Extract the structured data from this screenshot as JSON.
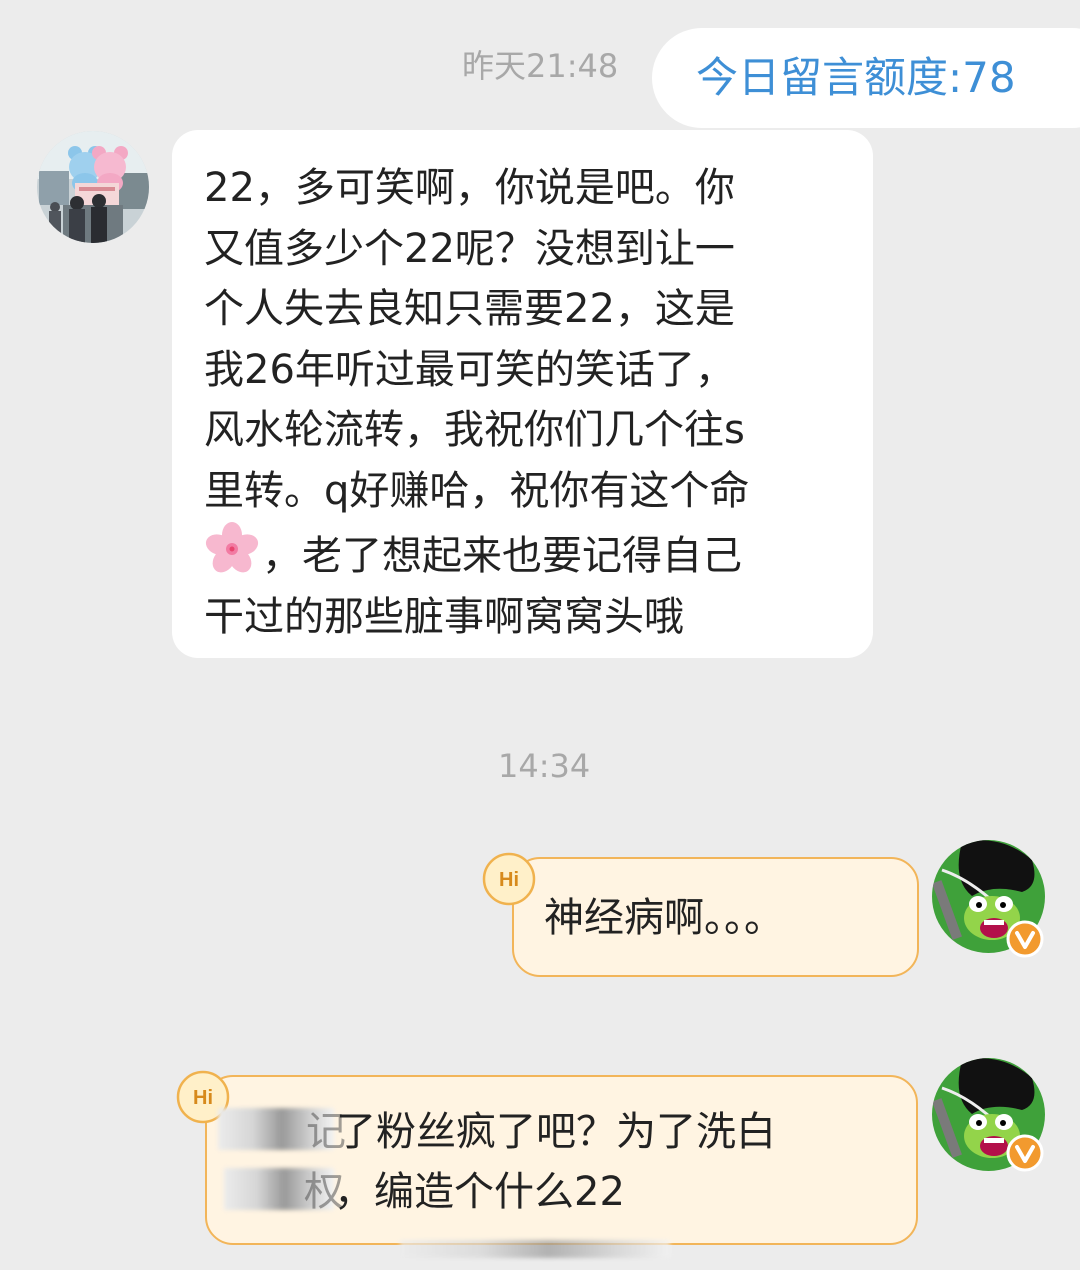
{
  "conversation": {
    "timestamps": {
      "first": "昨天21:48",
      "second": "14:34"
    },
    "quota": {
      "label": "今日留言额度:78"
    },
    "incoming_message": {
      "lines": [
        "22，多可笑啊，你说是吧。你",
        "又值多少个22呢？没想到让一",
        "个人失去良知只需要22，这是",
        "我26年听过最可笑的笑话了，",
        "风水轮流转，我祝你们几个往s",
        "里转。q好赚哈，祝你有这个命",
        "，老了想起来也要记得自己",
        "干过的那些脏事啊窝窝头哦"
      ],
      "emoji_icon": "cherry-blossom-icon"
    },
    "outgoing_messages": [
      {
        "lines": [
          "神经病啊。。。"
        ],
        "badge": "Hi"
      },
      {
        "lines": [
          "了粉丝疯了吧？为了洗白",
          "，编造个什么22"
        ],
        "partial_glyphs": [
          "记",
          "权"
        ],
        "badge": "Hi"
      }
    ]
  },
  "colors": {
    "background": "#ececec",
    "quota_text": "#3e8fd6",
    "bubble_outgoing_fill": "#fff4e2",
    "bubble_outgoing_border": "#f2b559",
    "timestamp_text": "#a8a8a8"
  }
}
